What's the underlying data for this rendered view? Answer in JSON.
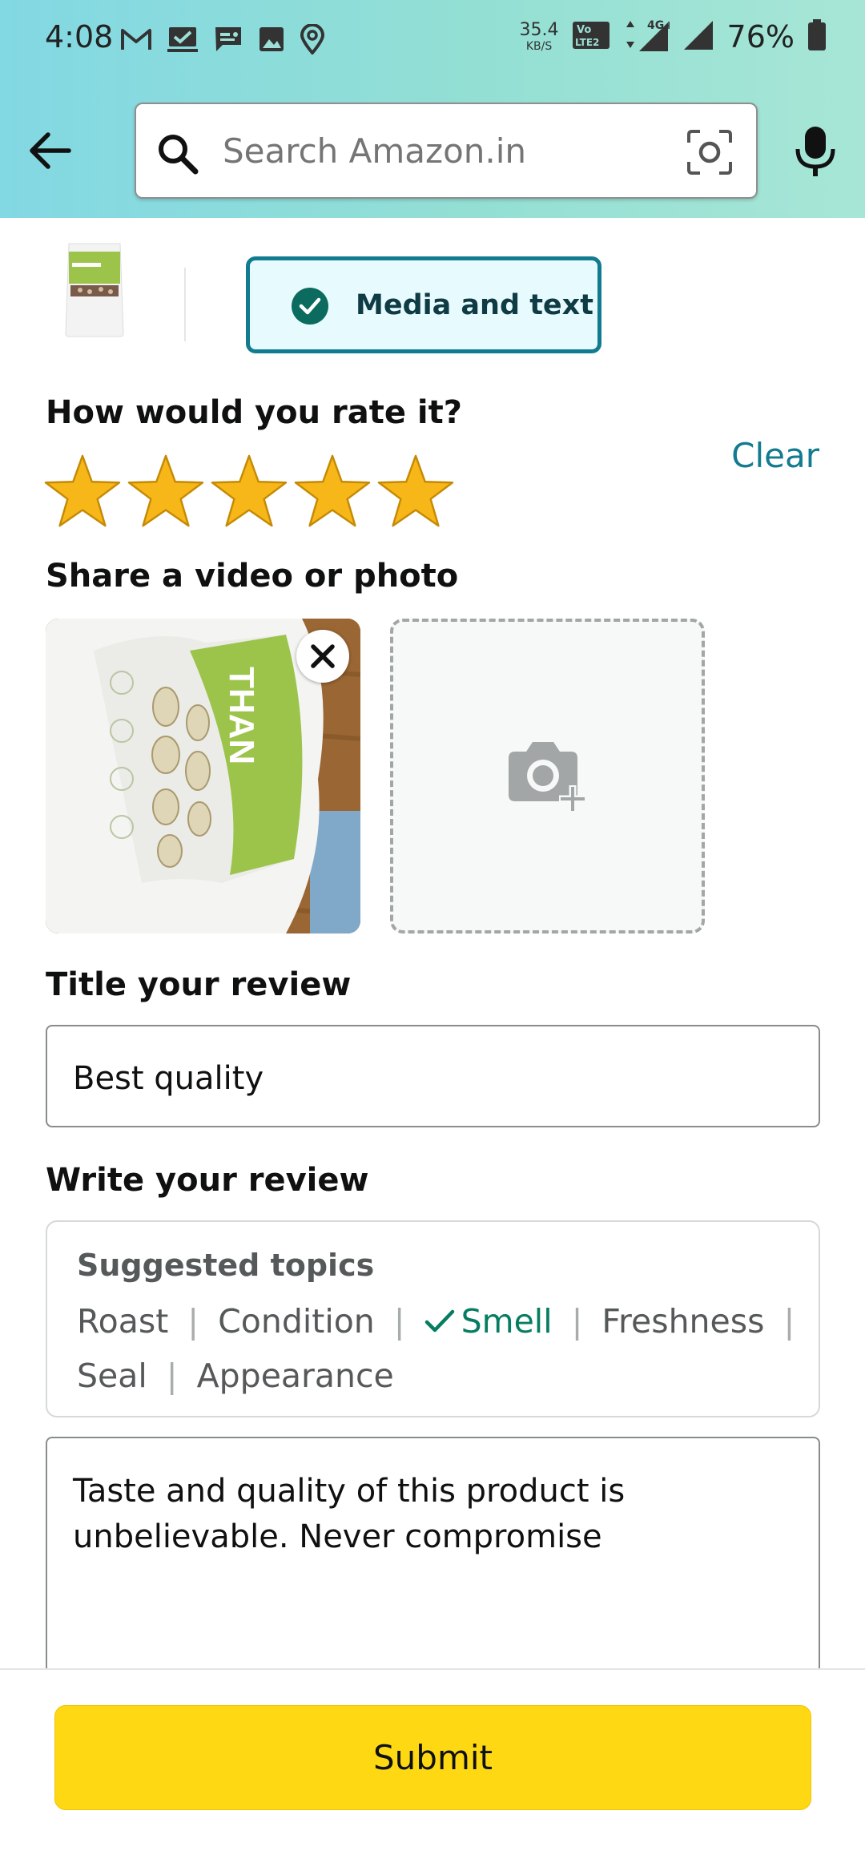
{
  "status_bar": {
    "time": "4:08",
    "net_speed_value": "35.4",
    "net_speed_unit": "KB/S",
    "battery_percent": "76%",
    "icons": [
      "gmail-icon",
      "tasks-icon",
      "chat-icon",
      "gallery-icon",
      "location-icon",
      "volte-icon",
      "signal-4g-icon",
      "signal-icon",
      "battery-icon"
    ]
  },
  "header": {
    "search_placeholder": "Search Amazon.in",
    "colors": {
      "gradient_left": "#82d8e3",
      "gradient_right": "#a7e6d6"
    }
  },
  "mode": {
    "label": "Media and text",
    "selected": true
  },
  "rating": {
    "heading": "How would you rate it?",
    "clear_label": "Clear",
    "stars": 5,
    "max_stars": 5
  },
  "media": {
    "heading": "Share a video or photo"
  },
  "title": {
    "heading": "Title your review",
    "value": "Best quality"
  },
  "review": {
    "heading": "Write your review",
    "topics_title": "Suggested topics",
    "topics": [
      {
        "label": "Roast",
        "selected": false
      },
      {
        "label": "Condition",
        "selected": false
      },
      {
        "label": "Smell",
        "selected": true
      },
      {
        "label": "Freshness",
        "selected": false
      },
      {
        "label": "Seal",
        "selected": false
      },
      {
        "label": "Appearance",
        "selected": false
      }
    ],
    "text": "Taste and quality of this product is unbelievable. Never compromise"
  },
  "footer": {
    "submit_label": "Submit",
    "colors": {
      "submit_bg": "#ffd814"
    }
  }
}
